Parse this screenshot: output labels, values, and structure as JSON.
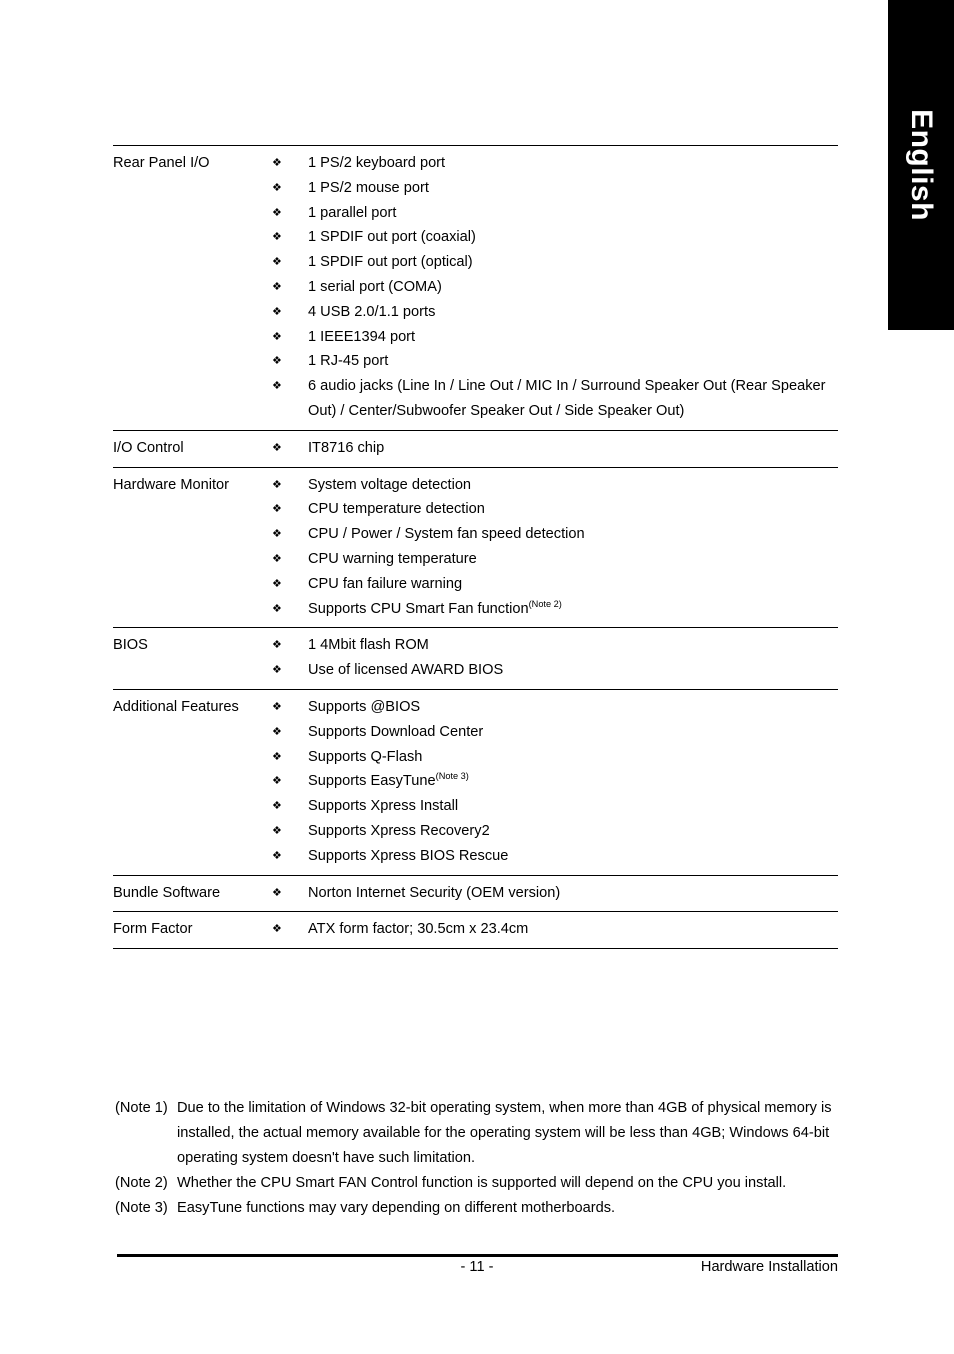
{
  "language_tab": {
    "label": "English"
  },
  "spec_table": {
    "rows": [
      {
        "category": "Rear Panel I/O",
        "items": [
          {
            "text": "1 PS/2 keyboard port"
          },
          {
            "text": "1 PS/2 mouse port"
          },
          {
            "text": "1 parallel port"
          },
          {
            "text": "1 SPDIF out port (coaxial)"
          },
          {
            "text": "1 SPDIF out port (optical)"
          },
          {
            "text": "1 serial port (COMA)"
          },
          {
            "text": "4 USB 2.0/1.1 ports"
          },
          {
            "text": "1 IEEE1394 port"
          },
          {
            "text": "1 RJ-45 port"
          },
          {
            "text": "6 audio jacks (Line In / Line Out / MIC In / Surround Speaker Out (Rear Speaker Out) / Center/Subwoofer Speaker Out / Side Speaker Out)"
          }
        ]
      },
      {
        "category": "I/O Control",
        "items": [
          {
            "text": "IT8716 chip"
          }
        ]
      },
      {
        "category": "Hardware Monitor",
        "items": [
          {
            "text": "System voltage detection"
          },
          {
            "text": "CPU temperature detection"
          },
          {
            "text": "CPU / Power / System fan speed detection"
          },
          {
            "text": "CPU warning temperature"
          },
          {
            "text": "CPU fan failure warning"
          },
          {
            "text": "Supports CPU Smart Fan function",
            "note": "(Note 2)"
          }
        ]
      },
      {
        "category": "BIOS",
        "items": [
          {
            "text": "1 4Mbit flash ROM"
          },
          {
            "text": "Use of licensed AWARD BIOS"
          }
        ]
      },
      {
        "category": "Additional Features",
        "items": [
          {
            "text": "Supports @BIOS"
          },
          {
            "text": "Supports Download Center"
          },
          {
            "text": "Supports Q-Flash"
          },
          {
            "text": "Supports EasyTune",
            "note": "(Note 3)"
          },
          {
            "text": "Supports Xpress Install"
          },
          {
            "text": "Supports Xpress Recovery2"
          },
          {
            "text": "Supports Xpress BIOS Rescue"
          }
        ]
      },
      {
        "category": "Bundle Software",
        "items": [
          {
            "text": "Norton Internet Security (OEM version)"
          }
        ]
      },
      {
        "category": "Form Factor",
        "items": [
          {
            "text": "ATX form factor; 30.5cm x 23.4cm"
          }
        ]
      }
    ],
    "bullet_glyph": "❖"
  },
  "footnotes": [
    {
      "label": "(Note 1)",
      "text": "Due to the limitation of Windows 32-bit operating system, when more than 4GB of physical memory is installed, the actual memory available for the operating system will be less than 4GB; Windows 64-bit operating system doesn't have such limitation."
    },
    {
      "label": "(Note 2)",
      "text": "Whether the CPU Smart FAN Control function is supported will depend on the CPU you install."
    },
    {
      "label": "(Note 3)",
      "text": "EasyTune functions may vary depending on different motherboards."
    }
  ],
  "footer": {
    "page_number": "- 11 -",
    "section_title": "Hardware Installation"
  }
}
